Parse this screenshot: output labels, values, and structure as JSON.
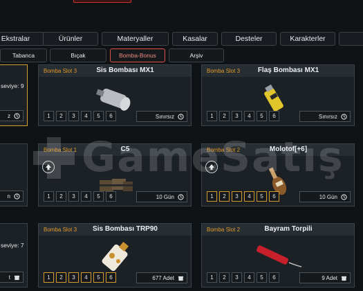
{
  "nav": {
    "categories": [
      "Ekstralar",
      "Ürünler",
      "Materyaller",
      "Kasalar",
      "Desteler",
      "Karakterler"
    ],
    "subcategories": [
      "Tabanca",
      "Bıçak",
      "Bomba-Bonus",
      "Arşiv"
    ],
    "active_subcategory": "Bomba-Bonus"
  },
  "cards": [
    {
      "slot": "Bomba Slot 3",
      "title": "Sis Bombası MX1",
      "duration": "Sınırsız",
      "levels": [
        "1",
        "2",
        "3",
        "4",
        "5",
        "6"
      ],
      "gold_levels": false,
      "upgradable": false
    },
    {
      "slot": "Bomba Slot 3",
      "title": "Flaş Bombası MX1",
      "duration": "Sınırsız",
      "levels": [
        "1",
        "2",
        "3",
        "4",
        "5",
        "6"
      ],
      "gold_levels": false,
      "upgradable": false
    },
    {
      "slot": "Bomba Slot 1",
      "title": "C5",
      "duration": "10 Gün",
      "levels": [
        "1",
        "2",
        "3",
        "4",
        "5",
        "6"
      ],
      "gold_levels": false,
      "upgradable": true
    },
    {
      "slot": "Bomba Slot 2",
      "title": "Molotof[+6]",
      "duration": "10 Gün",
      "levels": [
        "1",
        "2",
        "3",
        "4",
        "5",
        "6"
      ],
      "gold_levels": true,
      "upgradable": true
    },
    {
      "slot": "Bomba Slot 3",
      "title": "Sis Bombası TRP90",
      "duration": "677 Adet",
      "levels": [
        "1",
        "2",
        "3",
        "4",
        "5",
        "6"
      ],
      "gold_levels": true,
      "upgradable": false
    },
    {
      "slot": "Bomba Slot 2",
      "title": "Bayram Torpili",
      "duration": "9 Adet",
      "levels": [
        "1",
        "2",
        "3",
        "4",
        "5",
        "6"
      ],
      "gold_levels": false,
      "upgradable": false
    }
  ],
  "partial_cards": {
    "row1_level": "seviye: 9",
    "row1_duration": "z",
    "row2_duration": "n",
    "row3_level": "seviye: 7",
    "row3_duration": "t"
  },
  "watermark": "GameSatış",
  "colors": {
    "accent_orange": "#e39a2a",
    "active_red": "#e0544a",
    "bg": "#101316"
  }
}
